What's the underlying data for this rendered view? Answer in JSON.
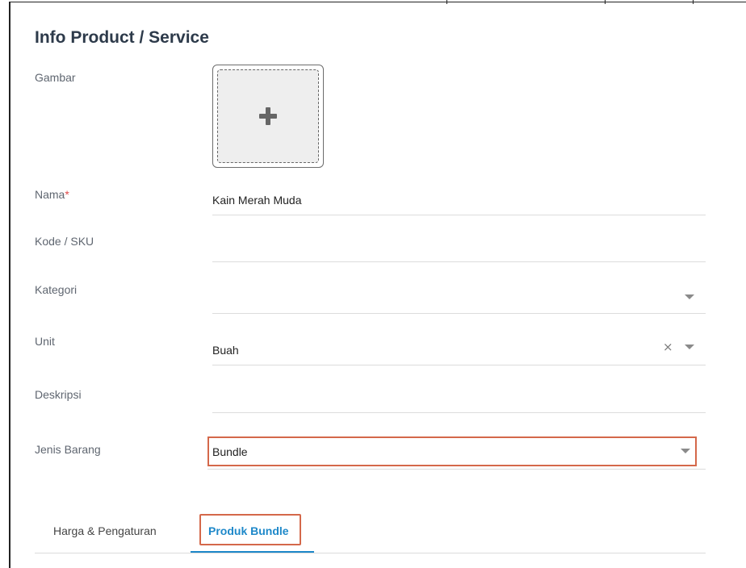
{
  "section": {
    "title": "Info Product / Service"
  },
  "labels": {
    "gambar": "Gambar",
    "nama": "Nama",
    "nama_required_mark": "*",
    "kode": "Kode / SKU",
    "kategori": "Kategori",
    "unit": "Unit",
    "deskripsi": "Deskripsi",
    "jenis_barang": "Jenis Barang"
  },
  "fields": {
    "nama": "Kain Merah Muda",
    "kode": "",
    "kategori": "",
    "unit": "Buah",
    "deskripsi": "",
    "jenis_barang": "Bundle"
  },
  "icons": {
    "upload": "plus-icon",
    "dropdown": "caret-down-icon",
    "clear": "clear-icon",
    "clear_glyph": "×"
  },
  "tabs": [
    {
      "label": "Harga & Pengaturan",
      "active": false
    },
    {
      "label": "Produk Bundle",
      "active": true
    }
  ],
  "colors": {
    "accent": "#1e88c9",
    "highlight": "#d4684a",
    "required": "#e04b4b"
  }
}
